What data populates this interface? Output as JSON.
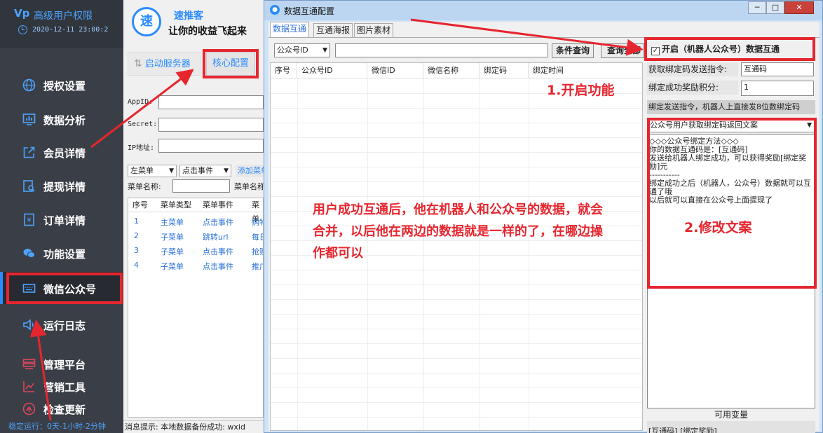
{
  "sidebar": {
    "logo": "Ⅴp",
    "title": "高级用户权限",
    "time": "2020-12-11 23:00:2",
    "items": [
      {
        "label": "授权设置",
        "icon": "globe-icon"
      },
      {
        "label": "数据分析",
        "icon": "chart-icon"
      },
      {
        "label": "会员详情",
        "icon": "external-link-icon"
      },
      {
        "label": "提现详情",
        "icon": "search-document-icon"
      },
      {
        "label": "订单详情",
        "icon": "receipt-icon"
      },
      {
        "label": "功能设置",
        "icon": "wechat-icon"
      },
      {
        "label": "微信公众号",
        "icon": "keyboard-icon"
      },
      {
        "label": "运行日志",
        "icon": "speaker-icon"
      },
      {
        "label": "管理平台",
        "icon": "layers-icon"
      },
      {
        "label": "营销工具",
        "icon": "bar-chart-icon"
      },
      {
        "label": "检查更新",
        "icon": "update-icon"
      }
    ],
    "footer": "稳定运行：0天-1小时-2分钟"
  },
  "main": {
    "brand_icon": "速",
    "brand_name": "速推客",
    "slogan": "让你的收益飞起来",
    "start_button": "启动服务器",
    "core_button": "核心配置",
    "fields": [
      {
        "label": "AppID:"
      },
      {
        "label": "Secret:"
      },
      {
        "label": "IP地址:"
      }
    ],
    "menu_type_select": "左菜单",
    "event_select": "点击事件",
    "add_menu": "添加菜单",
    "menu_name_label": "菜单名称:",
    "menu_name2_label": "菜单名称",
    "table_headers": [
      "序号",
      "菜单类型",
      "菜单事件",
      "菜单"
    ],
    "table_rows": [
      [
        "1",
        "主菜单",
        "点击事件",
        "购物"
      ],
      [
        "2",
        "子菜单",
        "跳转url",
        "每日"
      ],
      [
        "3",
        "子菜单",
        "点击事件",
        "抢购"
      ],
      [
        "4",
        "子菜单",
        "点击事件",
        "推广"
      ]
    ],
    "status": "消息提示:   本地数据备份成功: wxid"
  },
  "dialog": {
    "title": "数据互通配置",
    "win_minimize": "─",
    "win_maximize": "□",
    "win_close": "✕",
    "tabs": [
      "数据互通",
      "互通海报",
      "图片素材"
    ],
    "field_select": "公众号ID",
    "query_value": "",
    "query_button": "条件查询",
    "query_all_button": "查询全部",
    "table_headers": [
      "序号",
      "公众号ID",
      "微信ID",
      "微信名称",
      "绑定码",
      "绑定时间"
    ],
    "enable_checked": true,
    "enable_label": "开启（机器人公众号）数据互通",
    "bind_cmd_label": "获取绑定码发送指令:",
    "bind_cmd_value": "互通码",
    "reward_label": "绑定成功奖励积分:",
    "reward_value": "1",
    "note": "绑定发送指令，机器人上直接发8位数绑定码",
    "reply_select": "公众号用户获取绑定码返回文案",
    "reply_text": "◇◇◇公众号绑定方法◇◇◇\n你的数据互通码是：[互通码]\n发送给机器人绑定成功，可以获得奖励[绑定奖励]元\n-----------\n绑定成功之后（机器人，公众号）数据就可以互通了哦\n以后就可以直接在公众号上面提现了",
    "vars_title": "可用变量",
    "vars_text": "[互通码] [绑定奖励]"
  },
  "annotations": {
    "step1": "1.开启功能",
    "step2": "2.修改文案",
    "explain": "用户成功互通后，他在机器人和公众号的数据，就会合并，以后他在两边的数据就是一样的了，在哪边操作都可以"
  },
  "colors": {
    "accent": "#2a8bff",
    "highlight": "#e6262f",
    "sidebar_bg": "#3a3f47"
  }
}
